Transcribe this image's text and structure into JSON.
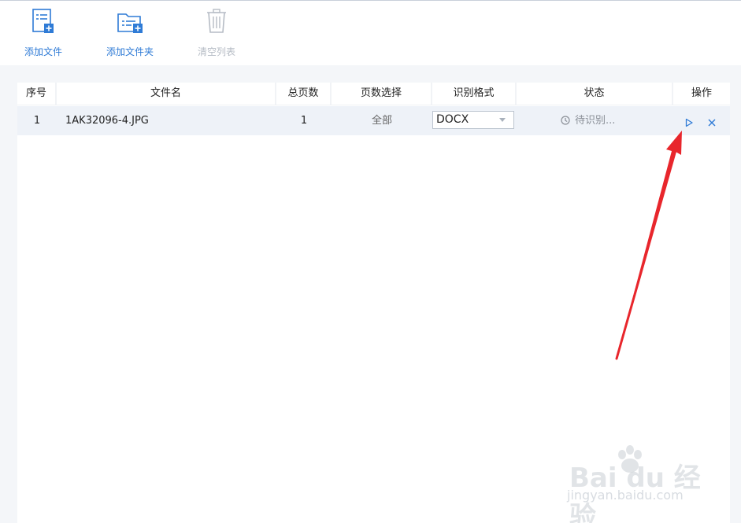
{
  "toolbar": {
    "add_file": "添加文件",
    "add_folder": "添加文件夹",
    "clear_list": "清空列表"
  },
  "table": {
    "headers": [
      "序号",
      "文件名",
      "总页数",
      "页数选择",
      "识别格式",
      "状态",
      "操作"
    ],
    "rows": [
      {
        "index": "1",
        "filename": "1AK32096-4.JPG",
        "total_pages": "1",
        "page_selection": "全部",
        "format": "DOCX",
        "status": "待识别..."
      }
    ]
  },
  "watermark": {
    "logo_text": "Bai du 经验",
    "url": "jingyan.baidu.com"
  },
  "colors": {
    "accent": "#2f7bd6",
    "disabled": "#b6bcc5",
    "row_bg": "#eef2f8",
    "arrow": "#e8262c"
  },
  "icons": {
    "add_file": "add-file-icon",
    "add_folder": "add-folder-icon",
    "clear_list": "trash-icon",
    "status": "clock-icon",
    "start": "play-icon",
    "remove": "close-icon"
  }
}
